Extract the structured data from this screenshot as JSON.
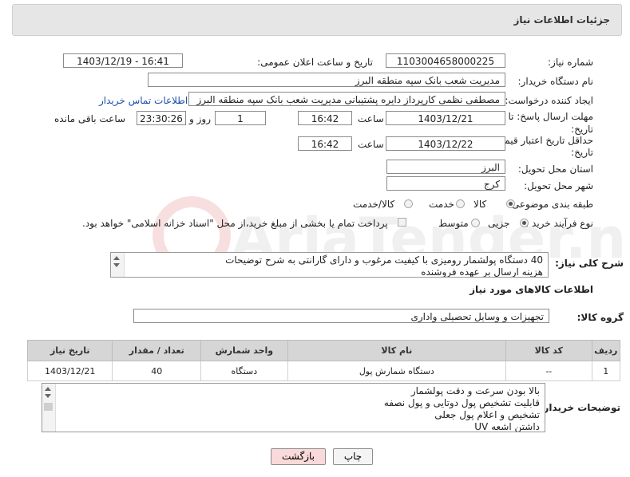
{
  "header": {
    "title": "جزئیات اطلاعات نیاز"
  },
  "fields": {
    "need_number_label": "شماره نیاز:",
    "need_number": "1103004658000225",
    "announce_label": "تاریخ و ساعت اعلان عمومی:",
    "announce_value": "1403/12/19 - 16:41",
    "buyer_label": "نام دستگاه خریدار:",
    "buyer_value": "مدیریت شعب بانک سپه منطقه البرز",
    "creator_label": "ایجاد کننده درخواست:",
    "creator_value": "مصطفی نظمی کارپرداز دایره پشتیبانی مدیریت شعب بانک سپه منطقه البرز",
    "contact_link": "اطلاعات تماس خریدار",
    "deadline_label_1": "مهلت ارسال پاسخ: تا",
    "deadline_label_2": "تاریخ:",
    "deadline_date": "1403/12/21",
    "time_label": "ساعت",
    "deadline_time": "16:42",
    "days_value": "1",
    "days_label": "روز و",
    "remaining_value": "23:30:26",
    "remaining_label": "ساعت باقی مانده",
    "validity_label_1": "حداقل تاریخ اعتبار قیمت: تا",
    "validity_label_2": "تاریخ:",
    "validity_date": "1403/12/22",
    "validity_time_label": "ساعت",
    "validity_time": "16:42",
    "province_label": "استان محل تحویل:",
    "province_value": "البرز",
    "city_label": "شهر محل تحویل:",
    "city_value": "کرج",
    "category_label": "طبقه بندی موضوعی:",
    "category_options": [
      "کالا",
      "خدمت",
      "کالا/خدمت"
    ],
    "process_label": "نوع فرآیند خرید :",
    "process_options": [
      "جزیی",
      "متوسط"
    ],
    "payment_note": "پرداخت تمام یا بخشی از مبلغ خرید،از محل \"اسناد خزانه اسلامی\" خواهد بود."
  },
  "description": {
    "label": "شرح کلی نیاز:",
    "lines": [
      "40 دستگاه پولشمار رومیزی با کیفیت مرغوب و دارای گارانتی به شرح توضیحات",
      "هزینه ارسال بر عهده فروشنده"
    ]
  },
  "goods": {
    "section_title": "اطلاعات کالاهای مورد نیاز",
    "group_label": "گروه کالا:",
    "group_value": "تجهیزات و وسایل تحصیلی واداری",
    "columns": [
      "ردیف",
      "کد کالا",
      "نام کالا",
      "واحد شمارش",
      "تعداد / مقدار",
      "تاریخ نیاز"
    ],
    "rows": [
      [
        "1",
        "--",
        "دستگاه شمارش پول",
        "دستگاه",
        "40",
        "1403/12/21"
      ]
    ]
  },
  "buyer_notes": {
    "label": "توضیحات خریدار:",
    "lines": [
      "بالا بودن سرعت و دقت پولشمار",
      "قابلیت تشخیص پول دوتایی و پول نصفه",
      "تشخیص و اعلام پول جعلی",
      "داشتن اشعه UV"
    ]
  },
  "buttons": {
    "print": "چاپ",
    "back": "بازگشت"
  },
  "watermark_text": "AriaTender.neT",
  "colors": {
    "header_bg": "#e6e6e6",
    "link": "#1a4fa8",
    "back_button_bg": "#f9d9d9",
    "table_header_bg": "#d6d6d6"
  }
}
